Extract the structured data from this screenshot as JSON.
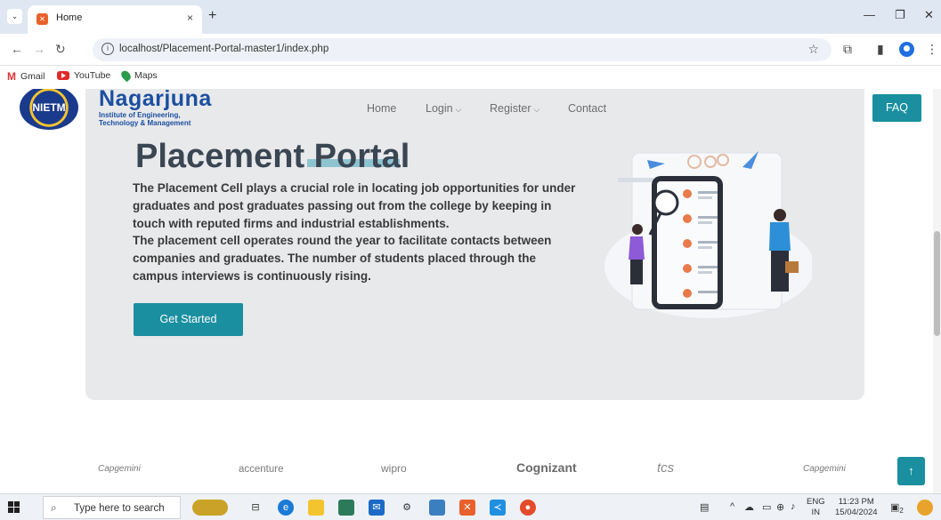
{
  "browser": {
    "tab_title": "Home",
    "tab_close": "×",
    "new_tab": "+",
    "url": "localhost/Placement-Portal-master1/index.php",
    "bookmarks": [
      {
        "label": "Gmail"
      },
      {
        "label": "YouTube"
      },
      {
        "label": "Maps"
      }
    ]
  },
  "site": {
    "logo_text": "NIETM",
    "brand_name": "Nagarjuna",
    "brand_sub_1": "Institute of Engineering,",
    "brand_sub_2": "Technology & Management",
    "nav": {
      "home": "Home",
      "login": "Login",
      "register": "Register",
      "contact": "Contact"
    },
    "faq": "FAQ"
  },
  "hero": {
    "title": "Placement Portal",
    "paragraph_1": "The Placement Cell plays a crucial role in locating job opportunities for under graduates and post graduates passing out from the college by keeping in touch with reputed firms and industrial establishments.",
    "paragraph_2": "The placement cell operates round the year to facilitate contacts between companies and graduates. The number of students placed through the campus interviews is continuously rising.",
    "cta": "Get Started"
  },
  "partners": [
    "Capgemini",
    "accenture",
    "wipro",
    "Cognizant",
    "tcs",
    "Capgemini"
  ],
  "back_to_top": "↑",
  "taskbar": {
    "search_placeholder": "Type here to search",
    "lang_1": "ENG",
    "lang_2": "IN",
    "time": "11:23 PM",
    "date": "15/04/2024",
    "notif_count": "2"
  },
  "colors": {
    "accent": "#1a8fa0",
    "brand": "#1b4fa0",
    "hero_bg": "#e8e9eb"
  }
}
